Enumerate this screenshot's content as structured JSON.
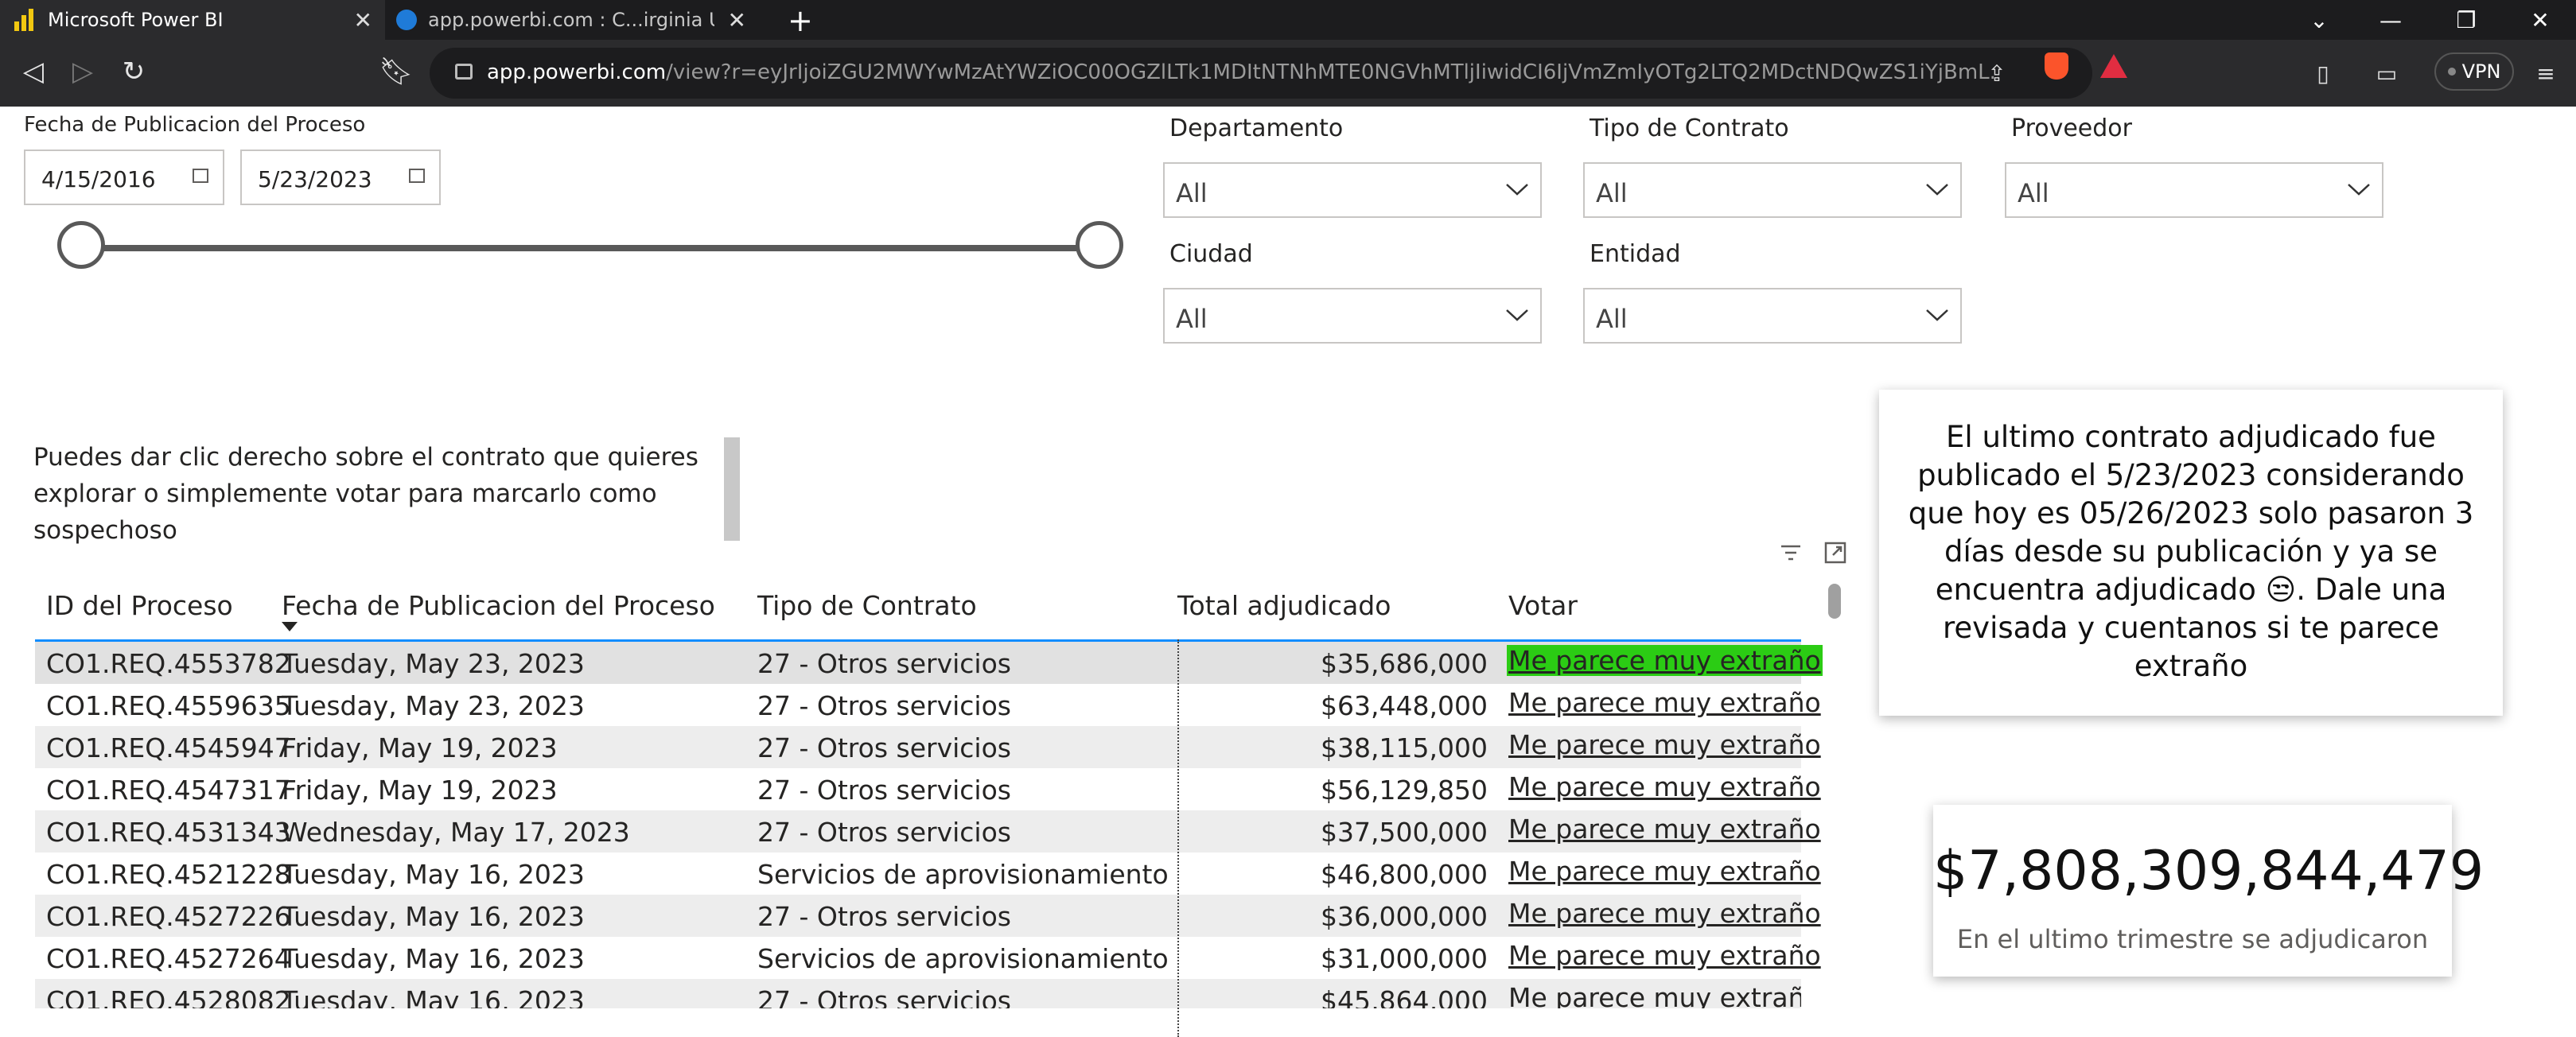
{
  "browser": {
    "tabs": [
      {
        "title": "Microsoft Power BI",
        "icon": "powerbi-icon",
        "active": true
      },
      {
        "title": "app.powerbi.com : C...irginia USA - EC",
        "icon": "edge-icon",
        "active": false
      }
    ],
    "url_host": "app.powerbi.com",
    "url_path": "/view?r=eyJrIjoiZGU2MWYwMzAtYWZiOC00OGZlLTk1MDItNTNhMTE0NGVhMTljIiwidCI6IjVmZmIyOTg2LTQ2MDctNDQwZS1iYjBmL...",
    "brave_badge": "1",
    "vpn_label": "VPN"
  },
  "filters": {
    "date": {
      "title": "Fecha de Publicacion del Proceso",
      "start": "4/15/2016",
      "end": "5/23/2023"
    },
    "departamento": {
      "title": "Departamento",
      "value": "All"
    },
    "tipo_contrato": {
      "title": "Tipo de Contrato",
      "value": "All"
    },
    "proveedor": {
      "title": "Proveedor",
      "value": "All"
    },
    "ciudad": {
      "title": "Ciudad",
      "value": "All"
    },
    "entidad": {
      "title": "Entidad",
      "value": "All"
    }
  },
  "hint": "Puedes dar clic derecho sobre el contrato que quieres explorar o simplemente votar para marcarlo como sospechoso",
  "table": {
    "headers": [
      "ID del Proceso",
      "Fecha de Publicacion del Proceso",
      "Tipo de Contrato",
      "Total adjudicado",
      "Votar"
    ],
    "rows": [
      {
        "id": "CO1.REQ.4553782",
        "fecha": "Tuesday, May 23, 2023",
        "tipo": "27 - Otros servicios",
        "total": "$35,686,000",
        "votar": "Me parece muy extraño"
      },
      {
        "id": "CO1.REQ.4559635",
        "fecha": "Tuesday, May 23, 2023",
        "tipo": "27 - Otros servicios",
        "total": "$63,448,000",
        "votar": "Me parece muy extraño"
      },
      {
        "id": "CO1.REQ.4545947",
        "fecha": "Friday, May 19, 2023",
        "tipo": "27 - Otros servicios",
        "total": "$38,115,000",
        "votar": "Me parece muy extraño"
      },
      {
        "id": "CO1.REQ.4547317",
        "fecha": "Friday, May 19, 2023",
        "tipo": "27 - Otros servicios",
        "total": "$56,129,850",
        "votar": "Me parece muy extraño"
      },
      {
        "id": "CO1.REQ.4531343",
        "fecha": "Wednesday, May 17, 2023",
        "tipo": "27 - Otros servicios",
        "total": "$37,500,000",
        "votar": "Me parece muy extraño"
      },
      {
        "id": "CO1.REQ.4521228",
        "fecha": "Tuesday, May 16, 2023",
        "tipo": "Servicios de aprovisionamiento",
        "total": "$46,800,000",
        "votar": "Me parece muy extraño"
      },
      {
        "id": "CO1.REQ.4527226",
        "fecha": "Tuesday, May 16, 2023",
        "tipo": "27 - Otros servicios",
        "total": "$36,000,000",
        "votar": "Me parece muy extraño"
      },
      {
        "id": "CO1.REQ.4527264",
        "fecha": "Tuesday, May 16, 2023",
        "tipo": "Servicios de aprovisionamiento",
        "total": "$31,000,000",
        "votar": "Me parece muy extraño"
      },
      {
        "id": "CO1.REQ.4528082",
        "fecha": "Tuesday, May 16, 2023",
        "tipo": "27 - Otros servicios",
        "total": "$45,864,000",
        "votar": "Me parece muy extraño"
      }
    ]
  },
  "card_message": "El ultimo contrato adjudicado fue publicado el 5/23/2023 considerando que hoy es 05/26/2023 solo pasaron 3 días desde su publicación y ya se encuentra adjudicado 😒. Dale una revisada y cuentanos si te parece extraño",
  "kpi": {
    "value": "$7,808,309,844,479",
    "label": "En el ultimo trimestre se adjudicaron"
  },
  "colors": {
    "highlight": "#2bcc14",
    "header_underline": "#118dff"
  }
}
